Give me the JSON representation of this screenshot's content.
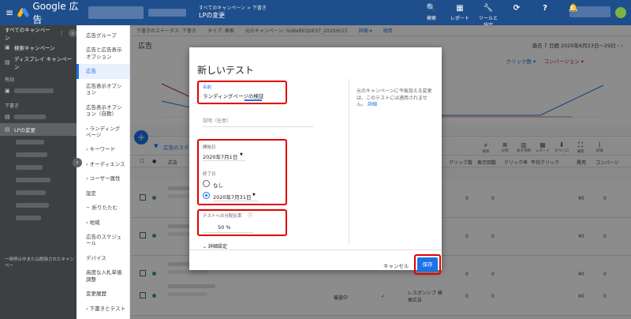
{
  "topbar": {
    "product": "Google 広告",
    "crumb_small": "すべてのキャンペーン > 下書き",
    "crumb_big": "LPの変更",
    "icons": [
      {
        "name": "search-icon",
        "glyph": "🔍",
        "label": "検索"
      },
      {
        "name": "report-icon",
        "glyph": "▦",
        "label": "レポート"
      },
      {
        "name": "tools-icon",
        "glyph": "🔧",
        "label": "ツールと設定"
      }
    ],
    "refresh_glyph": "⟳",
    "help_glyph": "?",
    "bell_glyph": "🔔",
    "menu_glyph": "≡"
  },
  "leftnav": {
    "all_campaigns": "すべてのキャンペーン",
    "items": [
      {
        "label": "検索キャンペーン",
        "icon": "▣"
      },
      {
        "label": "ディスプレイ キャンペーン",
        "icon": "▤"
      }
    ],
    "section_shared": "有効",
    "section_drafts": "下書き",
    "active_draft": "LPの変更",
    "footer": "一時停止中または削除されたキャンペー"
  },
  "subnav": {
    "items": [
      "広告グループ",
      "広告と広告表示オプション",
      "広告",
      "広告表示オプション",
      "広告表示オプション（自動）",
      "› ランディング ページ",
      "› キーワード",
      "› オーディエンス",
      "› ユーザー属性",
      "設定",
      "− 折りたたむ",
      "› 地域",
      "広告のスケジュール",
      "デバイス",
      "高度な入札単価調整",
      "変更履歴",
      "› 下書きとテスト"
    ],
    "active_index": 2
  },
  "main": {
    "status_items": [
      "下書きのステータス: 下書き",
      "タイプ: 検索",
      "元のキャンペーン: GoBeREQUEST_2020/6/15"
    ],
    "status_links": [
      "詳細 ▾",
      "適用"
    ],
    "page_title": "広告",
    "date_range": "過去 7 日間 2020年6月23日〜29日 ‹ ›",
    "legend": [
      "クリック数 ▾",
      "コンバージョン ▾"
    ],
    "filter_text": "広告のステ",
    "tools": [
      "検索",
      "分割",
      "表示項目",
      "レポート",
      "ダウンロード",
      "展開",
      "詳細"
    ],
    "columns": [
      "広告",
      "クリック数",
      "表示回数",
      "クリック率",
      "平均クリック",
      "費用",
      "コンバージ"
    ],
    "rows": [
      {
        "clicks": "0",
        "impr": "0",
        "cost": "¥0",
        "conv": "0"
      },
      {
        "clicks": "0",
        "impr": "0",
        "cost": "¥0",
        "conv": "0"
      },
      {
        "clicks": "0",
        "impr": "0",
        "cost": "¥0",
        "conv": "0"
      },
      {
        "clicks": "0",
        "impr": "0",
        "cost": "¥0",
        "conv": "0",
        "status": "審査中",
        "type": "レスポンシブ 検索広告"
      }
    ]
  },
  "dialog": {
    "title": "新しいテスト",
    "name_label": "名前",
    "name_value": "ランディングページの検証",
    "desc_placeholder": "説明（任意）",
    "start_label": "開始日",
    "start_value": "2020年7月1日",
    "end_label": "終了日",
    "end_none": "なし",
    "end_value": "2020年7月31日",
    "split_label": "テストへの分配比率",
    "split_value": "50 %",
    "advanced": "詳細設定",
    "side_info": "元のキャンペーンに今後加える変更は、このテストには適用されません。",
    "side_link": "詳細",
    "cancel": "キャンセル",
    "save": "保存"
  }
}
